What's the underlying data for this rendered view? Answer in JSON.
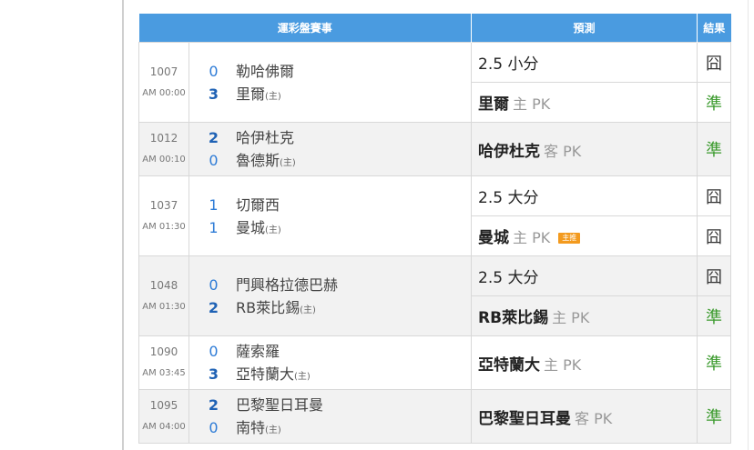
{
  "header": {
    "match_col": "運彩盤賽事",
    "pred_col": "預測",
    "result_col": "結果"
  },
  "host_mark": "(主)",
  "rows": [
    {
      "no": "1007",
      "time": "AM 00:00",
      "away": {
        "score": "0",
        "name": "勒哈佛爾"
      },
      "home": {
        "score": "3",
        "name": "里爾"
      },
      "preds": [
        {
          "main": "2.5 小分",
          "result": "囧"
        },
        {
          "team": "里爾",
          "side": "主 PK",
          "result": "準"
        }
      ]
    },
    {
      "no": "1012",
      "time": "AM 00:10",
      "away": {
        "score": "2",
        "name": "哈伊杜克"
      },
      "home": {
        "score": "0",
        "name": "魯德斯"
      },
      "preds": [
        {
          "team": "哈伊杜克",
          "side": "客 PK",
          "result": "準"
        }
      ]
    },
    {
      "no": "1037",
      "time": "AM 01:30",
      "away": {
        "score": "1",
        "name": "切爾西"
      },
      "home": {
        "score": "1",
        "name": "曼城"
      },
      "preds": [
        {
          "main": "2.5 大分",
          "result": "囧"
        },
        {
          "team": "曼城",
          "side": "主 PK",
          "badge": "主推",
          "result": "囧"
        }
      ]
    },
    {
      "no": "1048",
      "time": "AM 01:30",
      "away": {
        "score": "0",
        "name": "門興格拉德巴赫"
      },
      "home": {
        "score": "2",
        "name": "RB萊比錫"
      },
      "preds": [
        {
          "main": "2.5 大分",
          "result": "囧"
        },
        {
          "team": "RB萊比錫",
          "side": "主 PK",
          "result": "準"
        }
      ]
    },
    {
      "no": "1090",
      "time": "AM 03:45",
      "away": {
        "score": "0",
        "name": "薩索羅"
      },
      "home": {
        "score": "3",
        "name": "亞特蘭大"
      },
      "preds": [
        {
          "team": "亞特蘭大",
          "side": "主 PK",
          "result": "準"
        }
      ]
    },
    {
      "no": "1095",
      "time": "AM 04:00",
      "away": {
        "score": "2",
        "name": "巴黎聖日耳曼"
      },
      "home": {
        "score": "0",
        "name": "南特"
      },
      "preds": [
        {
          "team": "巴黎聖日耳曼",
          "side": "客 PK",
          "result": "準"
        }
      ]
    }
  ]
}
